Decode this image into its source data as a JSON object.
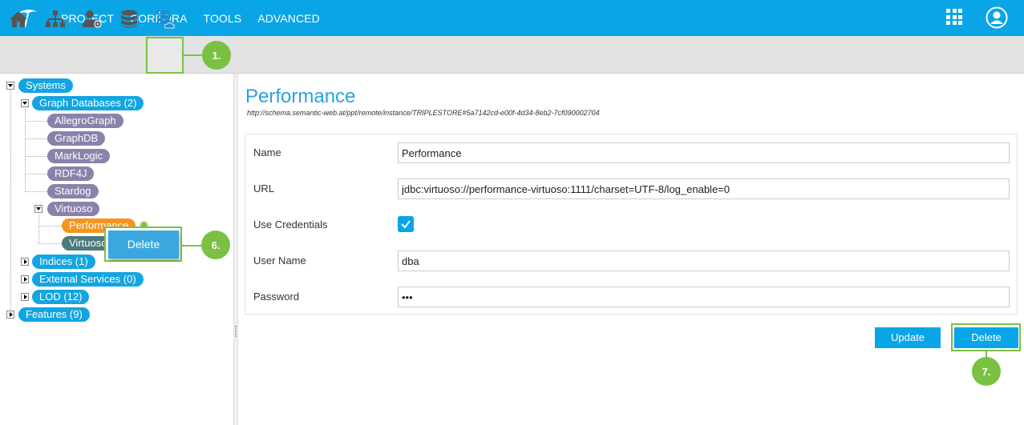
{
  "nav": {
    "items": [
      "PROJECT",
      "CORPORA",
      "TOOLS",
      "ADVANCED"
    ]
  },
  "toolbar": {
    "icons": [
      "home-icon",
      "sitemap-icon",
      "user-settings-icon",
      "database-icon",
      "triplestore-icon"
    ]
  },
  "callouts": {
    "c1": "1.",
    "c6": "6.",
    "c7": "7."
  },
  "tree": {
    "systems": "Systems",
    "graph_databases": "Graph Databases (2)",
    "allegrograph": "AllegroGraph",
    "graphdb": "GraphDB",
    "marklogic": "MarkLogic",
    "rdf4j": "RDF4J",
    "stardog": "Stardog",
    "virtuoso": "Virtuoso",
    "performance": "Performance",
    "virtuoso_child": "Virtuoso",
    "indices": "Indices (1)",
    "external_services": "External Services (0)",
    "lod": "LOD (12)",
    "features": "Features (9)"
  },
  "context_menu": {
    "delete_label": "Delete"
  },
  "detail": {
    "title": "Performance",
    "uri": "http://schema.semantic-web.at/ppt/remote/instance/TRIPLESTORE#5a7142cd-e00f-4d34-8eb2-7cf090002704",
    "fields": {
      "name_label": "Name",
      "name_value": "Performance",
      "url_label": "URL",
      "url_value": "jdbc:virtuoso://performance-virtuoso:1111/charset=UTF-8/log_enable=0",
      "credentials_label": "Use Credentials",
      "username_label": "User Name",
      "username_value": "dba",
      "password_label": "Password",
      "password_value": "•••"
    },
    "update_label": "Update",
    "delete_label": "Delete"
  },
  "colors": {
    "brand": "#0aa5e6",
    "callout": "#7ac143",
    "node_blue": "#13a5e2",
    "node_purple": "#8a82ab",
    "node_orange": "#f7941d",
    "node_teal": "#4d7a7d"
  }
}
